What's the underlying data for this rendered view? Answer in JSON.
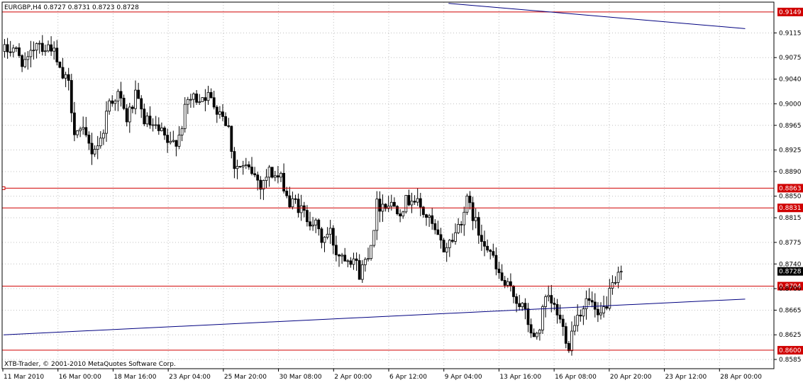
{
  "window": {
    "header_text": "EURGBP,H4  0.8727 0.8731 0.8723 0.8728",
    "copyright": "XTB-Trader, © 2001-2010 MetaQuotes Software Corp."
  },
  "colors": {
    "background": "#ffffff",
    "candle": "#000000",
    "grid": "#c0c0c0",
    "horizontal_line": "#d00000",
    "trendline": "#000080",
    "price_label_bg": "#d00000",
    "current_price_bg": "#000000"
  },
  "chart_data": {
    "type": "candlestick",
    "symbol": "EURGBP",
    "timeframe": "H4",
    "last_ohlc": {
      "open": 0.8727,
      "high": 0.8731,
      "low": 0.8723,
      "close": 0.8728
    },
    "ylim": [
      0.857,
      0.9165
    ],
    "y_ticks": [
      "0.9115",
      "0.9075",
      "0.9040",
      "0.9000",
      "0.8965",
      "0.8925",
      "0.8890",
      "0.8850",
      "0.8815",
      "0.8775",
      "0.8740",
      "0.8700",
      "0.8665",
      "0.8625",
      "0.8585"
    ],
    "x_ticks": [
      "11 Mar 2010",
      "16 Mar 00:00",
      "18 Mar 16:00",
      "23 Apr 04:00",
      "25 Mar 20:00",
      "30 Mar 08:00",
      "2 Apr 00:00",
      "6 Apr 12:00",
      "9 Apr 04:00",
      "13 Apr 16:00",
      "16 Apr 08:00",
      "20 Apr 20:00",
      "23 Apr 12:00",
      "28 Apr 00:00"
    ],
    "grid": true,
    "horizontal_levels": [
      {
        "price": 0.9149,
        "label": "0.9149"
      },
      {
        "price": 0.8863,
        "label": "0.8863"
      },
      {
        "price": 0.8831,
        "label": "0.8831"
      },
      {
        "price": 0.8704,
        "label": "0.8704"
      },
      {
        "price": 0.86,
        "label": "0.8600"
      }
    ],
    "current_price": {
      "price": 0.8728,
      "label": "0.8728"
    },
    "trendlines": [
      {
        "from": {
          "bar": 0,
          "price": 0.8625
        },
        "to": {
          "bar": 255,
          "price": 0.8683
        }
      },
      {
        "from": {
          "bar": 153,
          "price": 0.9163
        },
        "to": {
          "bar": 255,
          "price": 0.9122
        }
      }
    ],
    "anchors": [
      [
        0,
        0.9085
      ],
      [
        3,
        0.9092
      ],
      [
        5,
        0.9075
      ],
      [
        8,
        0.9065
      ],
      [
        11,
        0.9105
      ],
      [
        14,
        0.909
      ],
      [
        16,
        0.9095
      ],
      [
        19,
        0.905
      ],
      [
        22,
        0.903
      ],
      [
        24,
        0.896
      ],
      [
        27,
        0.895
      ],
      [
        30,
        0.8925
      ],
      [
        33,
        0.894
      ],
      [
        36,
        0.9005
      ],
      [
        39,
        0.9015
      ],
      [
        42,
        0.8975
      ],
      [
        45,
        0.901
      ],
      [
        48,
        0.8975
      ],
      [
        51,
        0.896
      ],
      [
        54,
        0.895
      ],
      [
        57,
        0.893
      ],
      [
        60,
        0.895
      ],
      [
        63,
        0.9005
      ],
      [
        66,
        0.901
      ],
      [
        69,
        0.9015
      ],
      [
        72,
        0.9
      ],
      [
        75,
        0.8985
      ],
      [
        77,
        0.896
      ],
      [
        79,
        0.89
      ],
      [
        82,
        0.8895
      ],
      [
        85,
        0.889
      ],
      [
        88,
        0.887
      ],
      [
        91,
        0.889
      ],
      [
        94,
        0.888
      ],
      [
        96,
        0.887
      ],
      [
        98,
        0.8835
      ],
      [
        100,
        0.884
      ],
      [
        103,
        0.882
      ],
      [
        106,
        0.881
      ],
      [
        109,
        0.878
      ],
      [
        112,
        0.879
      ],
      [
        114,
        0.876
      ],
      [
        117,
        0.8755
      ],
      [
        120,
        0.875
      ],
      [
        122,
        0.8725
      ],
      [
        124,
        0.8745
      ],
      [
        126,
        0.8775
      ],
      [
        128,
        0.8835
      ],
      [
        131,
        0.884
      ],
      [
        134,
        0.8835
      ],
      [
        136,
        0.883
      ],
      [
        138,
        0.884
      ],
      [
        140,
        0.885
      ],
      [
        143,
        0.883
      ],
      [
        146,
        0.881
      ],
      [
        149,
        0.878
      ],
      [
        151,
        0.8765
      ],
      [
        153,
        0.8775
      ],
      [
        155,
        0.879
      ],
      [
        157,
        0.8815
      ],
      [
        159,
        0.884
      ],
      [
        161,
        0.882
      ],
      [
        163,
        0.879
      ],
      [
        165,
        0.878
      ],
      [
        167,
        0.876
      ],
      [
        169,
        0.873
      ],
      [
        172,
        0.8705
      ],
      [
        175,
        0.869
      ],
      [
        178,
        0.867
      ],
      [
        180,
        0.8645
      ],
      [
        182,
        0.8615
      ],
      [
        184,
        0.864
      ],
      [
        186,
        0.868
      ],
      [
        188,
        0.8675
      ],
      [
        190,
        0.866
      ],
      [
        192,
        0.8635
      ],
      [
        194,
        0.861
      ],
      [
        196,
        0.865
      ],
      [
        198,
        0.8665
      ],
      [
        200,
        0.868
      ],
      [
        202,
        0.8675
      ],
      [
        204,
        0.8645
      ],
      [
        206,
        0.8665
      ],
      [
        208,
        0.869
      ],
      [
        210,
        0.8705
      ],
      [
        212,
        0.8728
      ]
    ],
    "title": "",
    "xlabel": "",
    "ylabel": ""
  }
}
